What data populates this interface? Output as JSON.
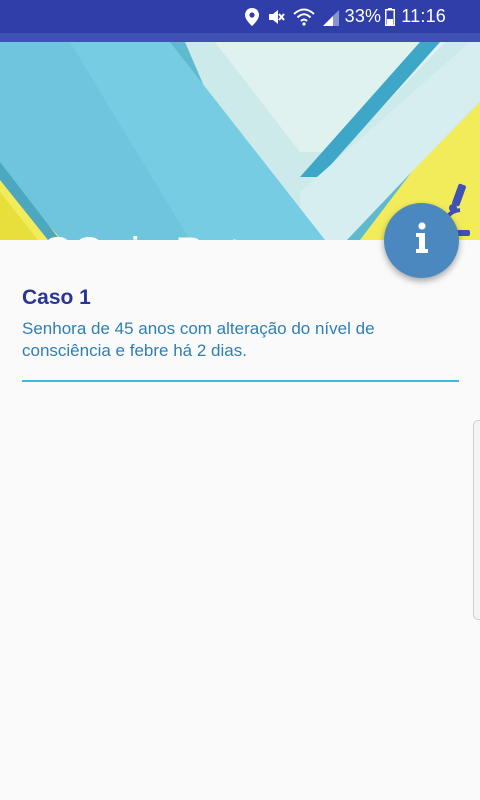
{
  "status_bar": {
    "battery_percent": "33%",
    "time": "11:16",
    "icons": [
      "location-icon",
      "mute-icon",
      "wifi-icon",
      "signal-icon",
      "battery-icon"
    ],
    "background_color": "#2f3ea8"
  },
  "header": {
    "title": "SQuiz Pato",
    "icons": [
      "microscope-icon"
    ]
  },
  "fab": {
    "icon": "info-icon",
    "color": "#4a88bf"
  },
  "cases": [
    {
      "title": "Caso 1",
      "description": "Senhora de 45 anos com alteração do nível de consciência e febre há 2 dias."
    }
  ],
  "colors": {
    "case_title": "#283593",
    "case_description": "#2e7fb3",
    "divider": "#33bfe0"
  }
}
